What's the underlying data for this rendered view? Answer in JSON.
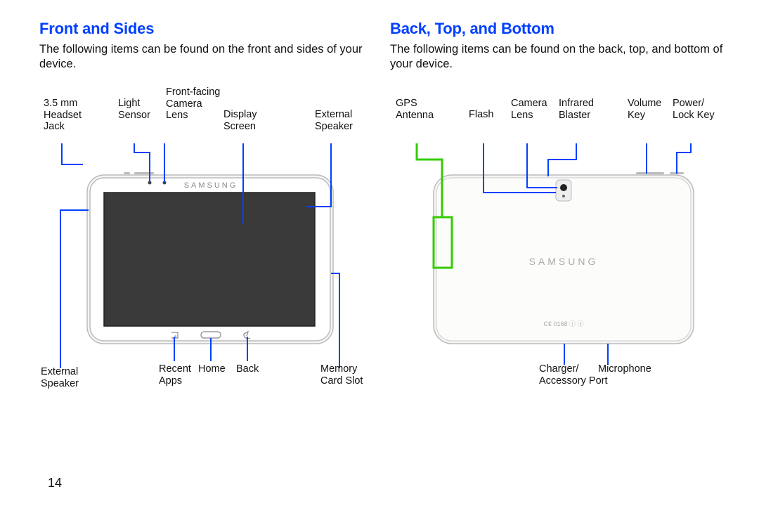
{
  "page_number": "14",
  "front": {
    "heading": "Front and Sides",
    "intro": "The following items can be found on the front and sides of your device.",
    "labels": {
      "headset_jack": "3.5 mm\nHeadset\nJack",
      "light_sensor": "Light\nSensor",
      "front_camera": "Front-facing\nCamera\nLens",
      "display_screen": "Display\nScreen",
      "external_speaker_right": "External\nSpeaker",
      "external_speaker_left": "External\nSpeaker",
      "recent_apps": "Recent\nApps",
      "home": "Home",
      "back": "Back",
      "memory_card_slot": "Memory\nCard Slot"
    },
    "brand": "SAMSUNG"
  },
  "back": {
    "heading": "Back, Top, and Bottom",
    "intro": "The following items can be found on the back, top, and bottom of your device.",
    "labels": {
      "gps_antenna": "GPS\nAntenna",
      "flash": "Flash",
      "camera_lens": "Camera\nLens",
      "ir_blaster": "Infrared\nBlaster",
      "volume_key": "Volume\nKey",
      "power_key": "Power/\nLock Key",
      "charger_port": "Charger/\nAccessory Port",
      "microphone": "Microphone"
    },
    "brand": "SAMSUNG",
    "cert": "C€ 0168 ⓘ ⓧ"
  }
}
